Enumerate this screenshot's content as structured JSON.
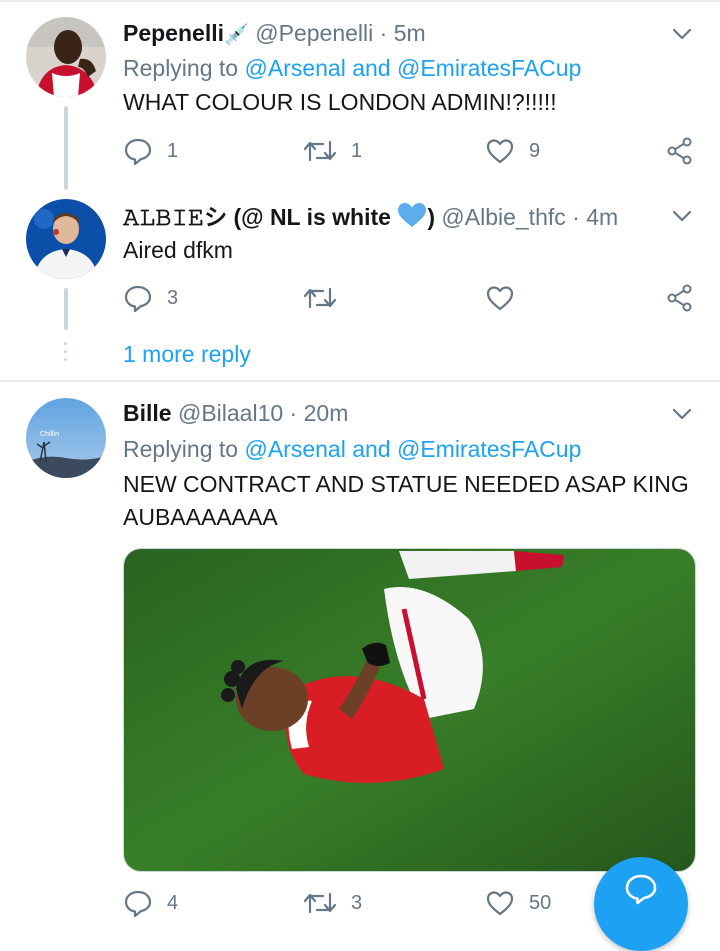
{
  "tweets": [
    {
      "name": "Pepenelli",
      "name_emoji": "💉",
      "handle": "@Pepenelli",
      "time": "5m",
      "replying_prefix": "Replying to",
      "replying_1": "@Arsenal",
      "replying_and": "and",
      "replying_2": "@EmiratesFACup",
      "text": "WHAT COLOUR IS LONDON ADMIN!?!!!!!",
      "replies": "1",
      "retweets": "1",
      "likes": "9"
    },
    {
      "name": "𝙰𝙻𝙱𝙸𝙴シ (@ NL is white",
      "name_suffix": ")",
      "handle": "@Albie_thfc",
      "time": "4m",
      "text": "Aired dfkm",
      "replies": "3",
      "retweets": "",
      "likes": ""
    },
    {
      "name": "Bille",
      "handle": "@Bilaal10",
      "time": "20m",
      "avatar_caption": "Chillin",
      "replying_prefix": "Replying to",
      "replying_1": "@Arsenal",
      "replying_and": "and",
      "replying_2": "@EmiratesFACup",
      "text": "NEW CONTRACT AND STATUE NEEDED ASAP KING AUBAAAAAAA",
      "replies": "4",
      "retweets": "3",
      "likes": "50"
    }
  ],
  "separator": "·",
  "more_replies": "1 more reply",
  "colors": {
    "link": "#1da1f2",
    "muted": "#657786",
    "text": "#14171a",
    "fab": "#1da1f2"
  },
  "icons": [
    "reply-icon",
    "retweet-icon",
    "like-icon",
    "share-icon",
    "caret-down-icon",
    "compose-icon",
    "blue-heart-icon"
  ]
}
